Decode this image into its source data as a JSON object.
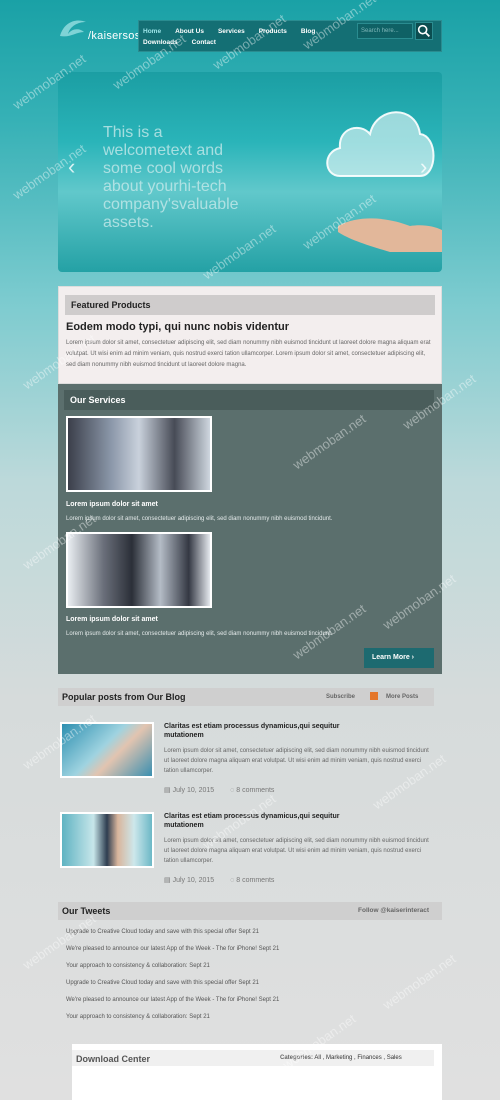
{
  "header": {
    "logo_text": "/kaisersosa",
    "nav": [
      "Home",
      "About Us",
      "Services",
      "Products",
      "Blog",
      "Downloads",
      "Contact"
    ],
    "search_placeholder": "Search here...",
    "search_icon": "magnifier-icon"
  },
  "slider": {
    "caption": "This is a welcometext and some cool words about yourhi-tech company'svaluable assets.",
    "prev_arrow": "‹",
    "next_arrow": "›"
  },
  "featured": {
    "heading": "Featured Products",
    "title": "Eodem modo typi, qui nunc nobis videntur",
    "text": "Lorem ipsum dolor sit amet, consectetuer adipiscing elit, sed diam nonummy nibh euismod tincidunt ut laoreet dolore magna aliquam erat volutpat. Ut wisi enim ad minim veniam, quis nostrud exerci tation ullamcorper. Lorem ipsum dolor sit amet, consectetuer adipiscing elit, sed diam nonummy nibh euismod tincidunt ut laoreet dolore magna."
  },
  "services": {
    "heading": "Our Services",
    "items": [
      {
        "title": "Lorem ipsum dolor sit amet",
        "text": "Lorem ipsum dolor sit amet, consectetuer adipiscing elit, sed diam nonummy nibh euismod tincidunt."
      },
      {
        "title": "Lorem ipsum dolor sit amet",
        "text": "Lorem ipsum dolor sit amet, consectetuer adipiscing elit, sed diam nonummy nibh euismod tincidunt."
      }
    ],
    "button": "Learn More ›"
  },
  "blog": {
    "heading": "Popular posts from Our Blog",
    "subscribe": "Subscribe",
    "more": "More Posts",
    "posts": [
      {
        "title": "Claritas est etiam processus dynamicus,qui sequitur mutationem",
        "text": "Lorem ipsum dolor sit amet, consectetuer adipiscing elit, sed diam nonummy nibh euismod tincidunt ut laoreet dolore magna aliquam erat volutpat. Ut wisi enim ad minim veniam, quis nostrud exerci tation ullamcorper.",
        "date": "July 10, 2015",
        "comments": "8 comments"
      },
      {
        "title": "Claritas est etiam processus dynamicus,qui sequitur mutationem",
        "text": "Lorem ipsum dolor sit amet, consectetuer adipiscing elit, sed diam nonummy nibh euismod tincidunt ut laoreet dolore magna aliquam erat volutpat. Ut wisi enim ad minim veniam, quis nostrud exerci tation ullamcorper.",
        "date": "July 10, 2015",
        "comments": "8 comments"
      }
    ]
  },
  "tweets": {
    "heading": "Our Tweets",
    "follow": "Follow @kaiserinteract",
    "items": [
      "Upgrade to Creative Cloud today and save with this special offer Sept 21",
      "We're pleased to announce our latest App of the Week - The for iPhone! Sept 21",
      "Your approach to consistency & collaboration: Sept 21",
      "Upgrade to Creative Cloud today and save with this special offer Sept 21",
      "We're pleased to announce our latest App of the Week - The for iPhone! Sept 21",
      "Your approach to consistency & collaboration: Sept 21"
    ]
  },
  "download": {
    "heading": "Download Center",
    "categories_label": "Categories:",
    "categories": "All , Marketing , Finances , Sales"
  },
  "watermark": "webmoban.net"
}
